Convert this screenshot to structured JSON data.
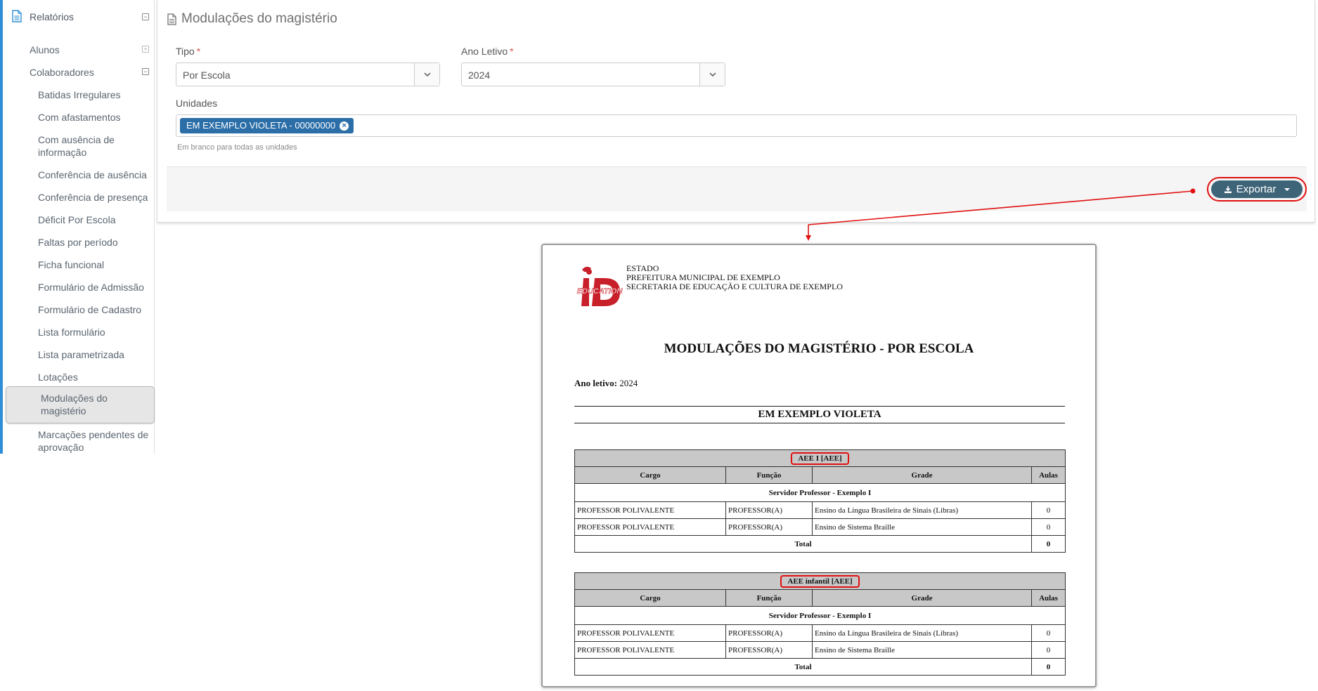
{
  "sidebar": {
    "section": "Relatórios",
    "items": [
      {
        "label": "Alunos"
      },
      {
        "label": "Colaboradores"
      }
    ],
    "subitems": [
      "Batidas Irregulares",
      "Com afastamentos",
      "Com ausência de informação",
      "Conferência de ausência",
      "Conferência de presença",
      "Déficit Por Escola",
      "Faltas por período",
      "Ficha funcional",
      "Formulário de Admissão",
      "Formulário de Cadastro",
      "Lista formulário",
      "Lista parametrizada",
      "Lotações",
      "Modulações do magistério",
      "Marcações pendentes de aprovação"
    ],
    "active": "Modulações do magistério"
  },
  "form": {
    "title": "Modulações do magistério",
    "tipo_label": "Tipo",
    "tipo_value": "Por Escola",
    "ano_label": "Ano Letivo",
    "ano_value": "2024",
    "required_mark": "*",
    "unidades_label": "Unidades",
    "unidade_tag": "EM EXEMPLO VIOLETA - 00000000",
    "unidades_hint": "Em branco para todas as unidades",
    "export_label": "Exportar"
  },
  "report": {
    "org_lines": [
      "ESTADO",
      "PREFEITURA MUNICIPAL DE EXEMPLO",
      "SECRETARIA DE EDUCAÇÃO E CULTURA DE EXEMPLO"
    ],
    "logo_text": "EDUCATION",
    "title": "MODULAÇÕES DO MAGISTÉRIO - POR ESCOLA",
    "ano_label": "Ano letivo:",
    "ano_value": "2024",
    "school": "EM EXEMPLO VIOLETA",
    "columns": [
      "Cargo",
      "Função",
      "Grade",
      "Aulas"
    ],
    "total_label": "Total",
    "groups": [
      {
        "name": "AEE I [AEE]",
        "servidor": "Servidor Professor - Exemplo I",
        "rows": [
          [
            "PROFESSOR POLIVALENTE",
            "PROFESSOR(A)",
            "Ensino da Língua Brasileira de Sinais (Libras)",
            "0"
          ],
          [
            "PROFESSOR POLIVALENTE",
            "PROFESSOR(A)",
            "Ensino de Sistema Braille",
            "0"
          ]
        ],
        "total": "0"
      },
      {
        "name": "AEE infantil [AEE]",
        "servidor": "Servidor Professor - Exemplo I",
        "rows": [
          [
            "PROFESSOR POLIVALENTE",
            "PROFESSOR(A)",
            "Ensino da Língua Brasileira de Sinais (Libras)",
            "0"
          ],
          [
            "PROFESSOR POLIVALENTE",
            "PROFESSOR(A)",
            "Ensino de Sistema Braille",
            "0"
          ]
        ],
        "total": "0"
      }
    ]
  },
  "colors": {
    "accent": "#2f8fd6",
    "tag": "#2b6ea8",
    "export_button": "#3e6478",
    "highlight": "#e01010",
    "required": "#d9534f"
  }
}
